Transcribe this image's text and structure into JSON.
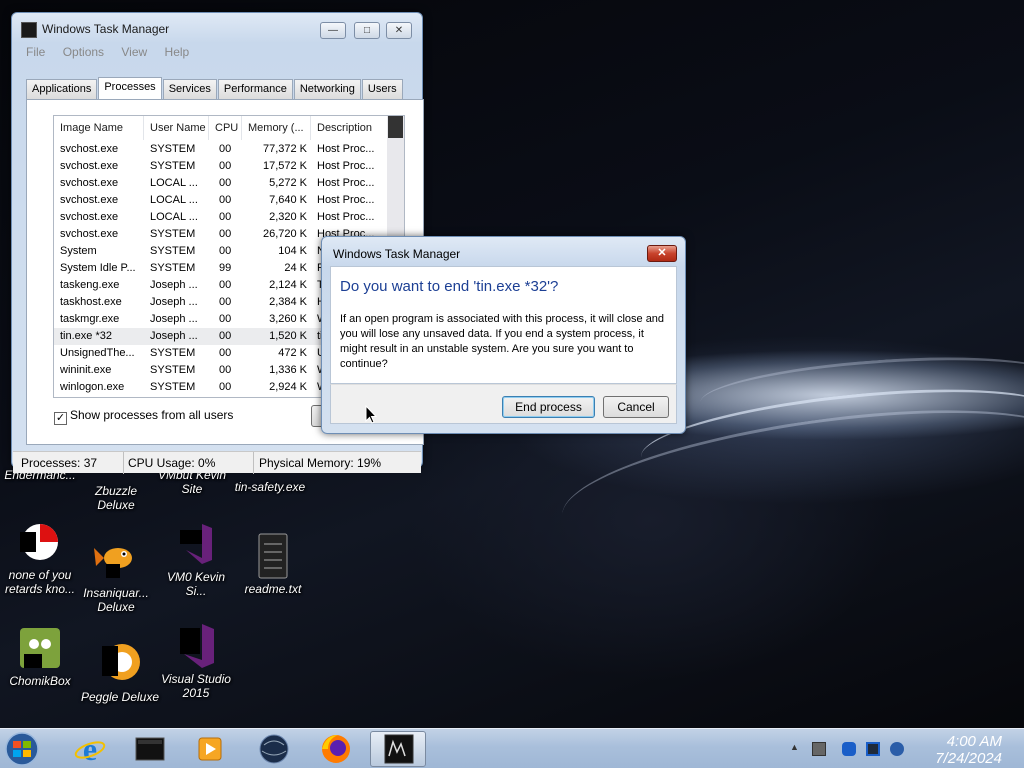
{
  "task_manager": {
    "title": "Windows Task Manager",
    "menu": [
      "File",
      "Options",
      "View",
      "Help"
    ],
    "tabs": [
      "Applications",
      "Processes",
      "Services",
      "Performance",
      "Networking",
      "Users"
    ],
    "columns": [
      "Image Name",
      "User Name",
      "CPU",
      "Memory (...",
      "Description"
    ],
    "rows": [
      [
        "svchost.exe",
        "SYSTEM",
        "00",
        "77,372 K",
        "Host Proc..."
      ],
      [
        "svchost.exe",
        "SYSTEM",
        "00",
        "17,572 K",
        "Host Proc..."
      ],
      [
        "svchost.exe",
        "LOCAL ...",
        "00",
        "5,272 K",
        "Host Proc..."
      ],
      [
        "svchost.exe",
        "LOCAL ...",
        "00",
        "7,640 K",
        "Host Proc..."
      ],
      [
        "svchost.exe",
        "LOCAL ...",
        "00",
        "2,320 K",
        "Host Proc..."
      ],
      [
        "svchost.exe",
        "SYSTEM",
        "00",
        "26,720 K",
        "Host Proc..."
      ],
      [
        "System",
        "SYSTEM",
        "00",
        "104 K",
        "NT"
      ],
      [
        "System Idle P...",
        "SYSTEM",
        "99",
        "24 K",
        "Per"
      ],
      [
        "taskeng.exe",
        "Joseph ...",
        "00",
        "2,124 K",
        "Tas"
      ],
      [
        "taskhost.exe",
        "Joseph ...",
        "00",
        "2,384 K",
        "Hos"
      ],
      [
        "taskmgr.exe",
        "Joseph ...",
        "00",
        "3,260 K",
        "Win"
      ],
      [
        "tin.exe *32",
        "Joseph ...",
        "00",
        "1,520 K",
        "tin."
      ],
      [
        "UnsignedThe...",
        "SYSTEM",
        "00",
        "472 K",
        "Uns"
      ],
      [
        "wininit.exe",
        "SYSTEM",
        "00",
        "1,336 K",
        "Win"
      ],
      [
        "winlogon.exe",
        "SYSTEM",
        "00",
        "2,924 K",
        "Win"
      ]
    ],
    "selected_row": 11,
    "show_all_label": "Show processes from all users",
    "end_button_label": "E",
    "status": {
      "processes": "Processes: 37",
      "cpu": "CPU Usage: 0%",
      "memory": "Physical Memory: 19%"
    }
  },
  "dialog": {
    "title": "Windows Task Manager",
    "heading": "Do you want to end 'tin.exe *32'?",
    "body": "If an open program is associated with this process, it will close and you will lose any unsaved data. If you end a system process, it might result in an unstable system. Are you sure you want to continue?",
    "end_label": "End process",
    "cancel_label": "Cancel"
  },
  "desktop_icons": [
    {
      "label": "Endermanc...",
      "icon": "game-icon"
    },
    {
      "label": "Zbuzzle Deluxe",
      "icon": "game-icon"
    },
    {
      "label": "VMbut Kevin Site",
      "icon": "shortcut-icon"
    },
    {
      "label": "tin-safety.exe",
      "icon": "executable-icon"
    },
    {
      "label": "none of you retards kno...",
      "icon": "pegasus-icon"
    },
    {
      "label": "Insaniquar... Deluxe",
      "icon": "fish-icon"
    },
    {
      "label": "VM0 Kevin Si...",
      "icon": "visual-studio-icon"
    },
    {
      "label": "readme.txt",
      "icon": "text-file-icon"
    },
    {
      "label": "ChomikBox",
      "icon": "chomikbox-icon"
    },
    {
      "label": "Peggle Deluxe",
      "icon": "peggle-icon"
    },
    {
      "label": "Visual Studio 2015",
      "icon": "visual-studio-icon"
    }
  ],
  "taskbar": {
    "items": [
      "start-orb",
      "internet-explorer",
      "libraries",
      "media-player",
      "network",
      "firefox",
      "task-manager"
    ],
    "time": "4:00 AM",
    "date": "7/24/2024"
  }
}
